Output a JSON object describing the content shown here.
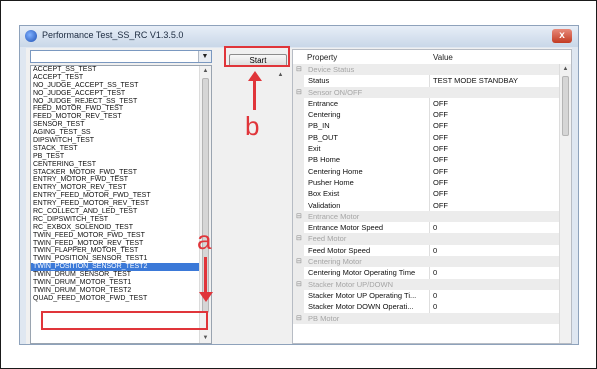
{
  "window": {
    "title": "Performance Test_SS_RC V1.3.5.0",
    "close_label": "x"
  },
  "combo": {
    "value": "",
    "arrow": "▼"
  },
  "test_list": {
    "items": [
      "ACCEPT_SS_TEST",
      "ACCEPT_TEST",
      "NO_JUDGE_ACCEPT_SS_TEST",
      "NO_JUDGE_ACCEPT_TEST",
      "NO_JUDGE_REJECT_SS_TEST",
      "FEED_MOTOR_FWD_TEST",
      "FEED_MOTOR_REV_TEST",
      "SENSOR_TEST",
      "AGING_TEST_SS",
      "DIPSWITCH_TEST",
      "STACK_TEST",
      "PB_TEST",
      "CENTERING_TEST",
      "STACKER_MOTOR_FWD_TEST",
      "ENTRY_MOTOR_FWD_TEST",
      "ENTRY_MOTOR_REV_TEST",
      "ENTRY_FEED_MOTOR_FWD_TEST",
      "ENTRY_FEED_MOTOR_REV_TEST",
      "RC_COLLECT_AND_LED_TEST",
      "RC_DIPSWITCH_TEST",
      "RC_EXBOX_SOLENOID_TEST",
      "TWIN_FEED_MOTOR_FWD_TEST",
      "TWIN_FEED_MOTOR_REV_TEST",
      "TWIN_FLAPPER_MOTOR_TEST",
      "TWIN_POSITION_SENSOR_TEST1",
      "TWIN_POSITION_SENSOR_TEST2",
      "TWIN_DRUM_SENSOR_TEST",
      "TWIN_DRUM_MOTOR_TEST1",
      "TWIN_DRUM_MOTOR_TEST2",
      "QUAD_FEED_MOTOR_FWD_TEST"
    ],
    "selected_index": 25
  },
  "start_button": {
    "label": "Start"
  },
  "property_grid": {
    "header": {
      "property": "Property",
      "value": "Value"
    },
    "rows": [
      {
        "kind": "cat",
        "name": "Device Status"
      },
      {
        "kind": "item",
        "name": "Status",
        "value": "TEST MODE STANDBAY"
      },
      {
        "kind": "cat",
        "name": "Sensor ON/OFF"
      },
      {
        "kind": "item",
        "name": "Entrance",
        "value": "OFF"
      },
      {
        "kind": "item",
        "name": "Centering",
        "value": "OFF"
      },
      {
        "kind": "item",
        "name": "PB_IN",
        "value": "OFF"
      },
      {
        "kind": "item",
        "name": "PB_OUT",
        "value": "OFF"
      },
      {
        "kind": "item",
        "name": "Exit",
        "value": "OFF"
      },
      {
        "kind": "item",
        "name": "PB Home",
        "value": "OFF"
      },
      {
        "kind": "item",
        "name": "Centering Home",
        "value": "OFF"
      },
      {
        "kind": "item",
        "name": "Pusher Home",
        "value": "OFF"
      },
      {
        "kind": "item",
        "name": "Box Exist",
        "value": "OFF"
      },
      {
        "kind": "item",
        "name": "Validation",
        "value": "OFF"
      },
      {
        "kind": "cat",
        "name": "Entrance Motor"
      },
      {
        "kind": "item",
        "name": "Entrance Motor Speed",
        "value": "0"
      },
      {
        "kind": "cat",
        "name": "Feed Motor"
      },
      {
        "kind": "item",
        "name": "Feed Motor Speed",
        "value": "0"
      },
      {
        "kind": "cat",
        "name": "Centering Motor"
      },
      {
        "kind": "item",
        "name": "Centering Motor Operating Time",
        "value": "0"
      },
      {
        "kind": "cat",
        "name": "Stacker Motor UP/DOWN"
      },
      {
        "kind": "item",
        "name": "Stacker Motor UP Operating Ti...",
        "value": "0"
      },
      {
        "kind": "item",
        "name": "Stacker Motor DOWN Operati...",
        "value": "0"
      },
      {
        "kind": "cat",
        "name": "PB Motor"
      }
    ]
  },
  "annotations": {
    "a": "a",
    "b": "b"
  },
  "colors": {
    "highlight": "#e0353a",
    "selection": "#3b79d8",
    "category_bg": "#ececec"
  }
}
